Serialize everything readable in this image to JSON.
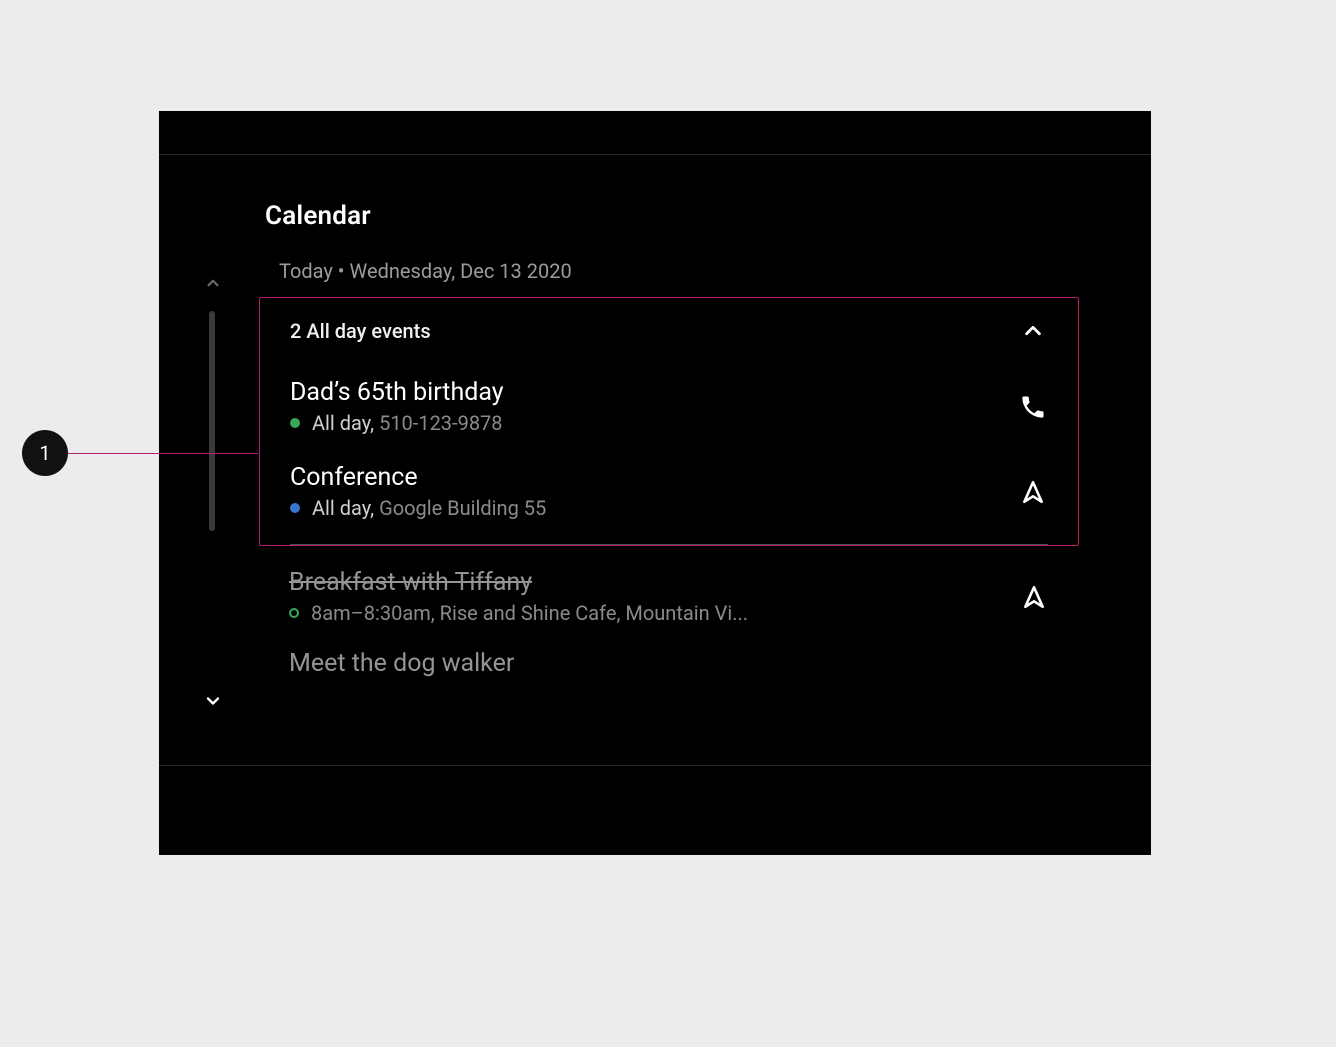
{
  "annotation": {
    "label": "1"
  },
  "app": {
    "title": "Calendar",
    "date_line": "Today • Wednesday, Dec 13 2020"
  },
  "all_day_section": {
    "header": "2 All day events",
    "events": [
      {
        "title": "Dad’s 65th birthday",
        "meta_primary": "All day,",
        "meta_secondary": "510-123-9878",
        "dot_color": "green",
        "action": "phone"
      },
      {
        "title": "Conference",
        "meta_primary": "All day,",
        "meta_secondary": "Google Building 55",
        "dot_color": "blue",
        "action": "navigate"
      }
    ]
  },
  "timed_events": [
    {
      "title": "Breakfast with Tiffany",
      "struck": true,
      "meta_primary": "8am–8:30am,",
      "meta_secondary": "Rise and Shine Cafe, Mountain Vi...",
      "dot_color": "green-outline",
      "action": "navigate"
    },
    {
      "title": "Meet the dog walker",
      "dim": true
    }
  ]
}
